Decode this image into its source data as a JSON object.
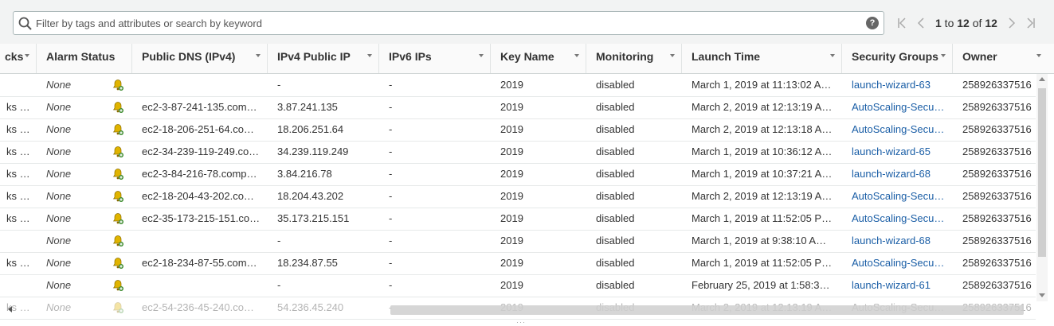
{
  "search": {
    "placeholder": "Filter by tags and attributes or search by keyword"
  },
  "help": {
    "label": "?"
  },
  "pagination": {
    "range_start": "1",
    "range_to": " to ",
    "range_end": "12",
    "range_of": " of ",
    "total": "12"
  },
  "columns": [
    {
      "label": "cks"
    },
    {
      "label": "Alarm Status"
    },
    {
      "label": "Public DNS (IPv4)"
    },
    {
      "label": "IPv4 Public IP"
    },
    {
      "label": "IPv6 IPs"
    },
    {
      "label": "Key Name"
    },
    {
      "label": "Monitoring"
    },
    {
      "label": "Launch Time"
    },
    {
      "label": "Security Groups"
    },
    {
      "label": "Owner"
    }
  ],
  "rows": [
    {
      "checks": "",
      "alarm": "None",
      "dns": "",
      "ipv4": "-",
      "ipv6": "-",
      "key": "2019",
      "monitoring": "disabled",
      "launch": "March 1, 2019 at 11:13:02 A…",
      "sg": "launch-wizard-63",
      "owner": "258926337516"
    },
    {
      "checks": "ks …",
      "alarm": "None",
      "dns": "ec2-3-87-241-135.com…",
      "ipv4": "3.87.241.135",
      "ipv6": "-",
      "key": "2019",
      "monitoring": "disabled",
      "launch": "March 2, 2019 at 12:13:19 A…",
      "sg": "AutoScaling-Secu…",
      "owner": "258926337516"
    },
    {
      "checks": "ks …",
      "alarm": "None",
      "dns": "ec2-18-206-251-64.co…",
      "ipv4": "18.206.251.64",
      "ipv6": "-",
      "key": "2019",
      "monitoring": "disabled",
      "launch": "March 2, 2019 at 12:13:18 A…",
      "sg": "AutoScaling-Secu…",
      "owner": "258926337516"
    },
    {
      "checks": "ks …",
      "alarm": "None",
      "dns": "ec2-34-239-119-249.co…",
      "ipv4": "34.239.119.249",
      "ipv6": "-",
      "key": "2019",
      "monitoring": "disabled",
      "launch": "March 1, 2019 at 10:36:12 A…",
      "sg": "launch-wizard-65",
      "owner": "258926337516"
    },
    {
      "checks": "ks …",
      "alarm": "None",
      "dns": "ec2-3-84-216-78.comp…",
      "ipv4": "3.84.216.78",
      "ipv6": "-",
      "key": "2019",
      "monitoring": "disabled",
      "launch": "March 1, 2019 at 10:37:21 A…",
      "sg": "launch-wizard-68",
      "owner": "258926337516"
    },
    {
      "checks": "ks …",
      "alarm": "None",
      "dns": "ec2-18-204-43-202.co…",
      "ipv4": "18.204.43.202",
      "ipv6": "-",
      "key": "2019",
      "monitoring": "disabled",
      "launch": "March 2, 2019 at 12:13:19 A…",
      "sg": "AutoScaling-Secu…",
      "owner": "258926337516"
    },
    {
      "checks": "ks …",
      "alarm": "None",
      "dns": "ec2-35-173-215-151.co…",
      "ipv4": "35.173.215.151",
      "ipv6": "-",
      "key": "2019",
      "monitoring": "disabled",
      "launch": "March 1, 2019 at 11:52:05 P…",
      "sg": "AutoScaling-Secu…",
      "owner": "258926337516"
    },
    {
      "checks": "",
      "alarm": "None",
      "dns": "",
      "ipv4": "-",
      "ipv6": "-",
      "key": "2019",
      "monitoring": "disabled",
      "launch": "March 1, 2019 at 9:38:10 A…",
      "sg": "launch-wizard-68",
      "owner": "258926337516"
    },
    {
      "checks": "ks …",
      "alarm": "None",
      "dns": "ec2-18-234-87-55.com…",
      "ipv4": "18.234.87.55",
      "ipv6": "-",
      "key": "2019",
      "monitoring": "disabled",
      "launch": "March 1, 2019 at 11:52:05 P…",
      "sg": "AutoScaling-Secu…",
      "owner": "258926337516"
    },
    {
      "checks": "",
      "alarm": "None",
      "dns": "",
      "ipv4": "-",
      "ipv6": "-",
      "key": "2019",
      "monitoring": "disabled",
      "launch": "February 25, 2019 at 1:58:3…",
      "sg": "launch-wizard-61",
      "owner": "258926337516"
    },
    {
      "checks": "ks …",
      "alarm": "None",
      "dns": "ec2-54-236-45-240.co…",
      "ipv4": "54.236.45.240",
      "ipv6": "-",
      "key": "2019",
      "monitoring": "disabled",
      "launch": "March 2, 2019 at 12:13:19 A…",
      "sg": "AutoScaling-Secu…",
      "owner": "258926337516"
    }
  ],
  "colors": {
    "link": "#1a5ea6",
    "header_bg": "#fafafa",
    "toolbar_bg": "#f2f3f3"
  }
}
